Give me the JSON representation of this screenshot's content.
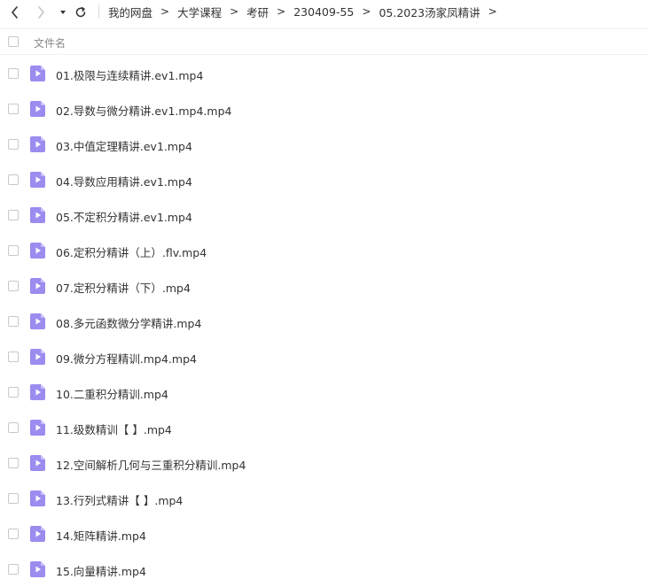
{
  "navigation": {
    "back_icon": "chevron-left-icon",
    "forward_icon": "chevron-right-icon",
    "dropdown_icon": "caret-down-icon",
    "refresh_icon": "refresh-icon",
    "forward_disabled": true
  },
  "breadcrumb": {
    "items": [
      "我的网盘",
      "大学课程",
      "考研",
      "230409-55",
      "05.2023汤家凤精讲"
    ],
    "separator": ">"
  },
  "header": {
    "column_label": "文件名"
  },
  "files": [
    {
      "name": "01.极限与连续精讲.ev1.mp4"
    },
    {
      "name": "02.导数与微分精讲.ev1.mp4.mp4"
    },
    {
      "name": "03.中值定理精讲.ev1.mp4"
    },
    {
      "name": "04.导数应用精讲.ev1.mp4"
    },
    {
      "name": "05.不定积分精讲.ev1.mp4"
    },
    {
      "name": "06.定积分精讲（上）.flv.mp4"
    },
    {
      "name": "07.定积分精讲（下）.mp4"
    },
    {
      "name": "08.多元函数微分学精讲.mp4"
    },
    {
      "name": "09.微分方程精训.mp4.mp4"
    },
    {
      "name": "10.二重积分精训.mp4"
    },
    {
      "name": "11.级数精训【 】.mp4"
    },
    {
      "name": "12.空间解析几何与三重积分精训.mp4"
    },
    {
      "name": "13.行列式精讲【 】.mp4"
    },
    {
      "name": "14.矩阵精讲.mp4"
    },
    {
      "name": "15.向量精讲.mp4"
    }
  ],
  "colors": {
    "video_icon": "#9b8cf0",
    "video_icon_fold": "#c9c0fa",
    "text": "#333333",
    "muted": "#888888",
    "border": "#f0f0f0"
  }
}
